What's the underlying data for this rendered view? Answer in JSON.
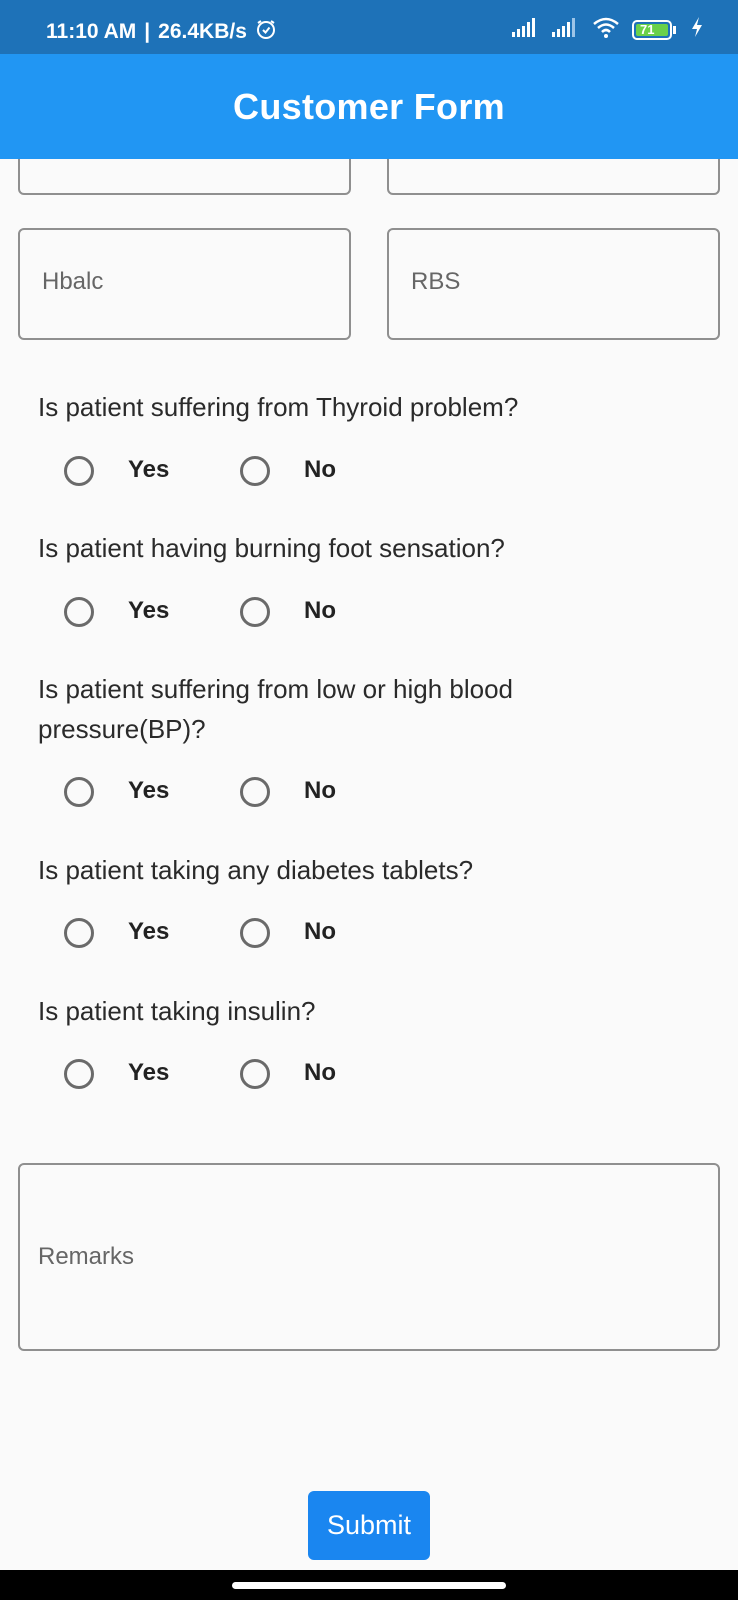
{
  "status_bar": {
    "time": "11:10 AM",
    "speed": "26.4KB/s",
    "battery": "71",
    "icons": [
      "alarm-icon",
      "signal-icon",
      "signal-icon",
      "wifi-icon",
      "battery-icon",
      "charging-icon"
    ]
  },
  "app_bar": {
    "title": "Customer Form"
  },
  "fields": {
    "hba1c_placeholder": "Hbalc",
    "rbs_placeholder": "RBS",
    "remarks_placeholder": "Remarks"
  },
  "questions": [
    {
      "text": "Is patient suffering from Thyroid problem?",
      "yes": "Yes",
      "no": "No"
    },
    {
      "text": "Is patient having burning foot sensation?",
      "yes": "Yes",
      "no": "No"
    },
    {
      "text": "Is patient suffering from low or high blood pressure(BP)?",
      "yes": "Yes",
      "no": "No"
    },
    {
      "text": "Is patient taking any diabetes tablets?",
      "yes": "Yes",
      "no": "No"
    },
    {
      "text": "Is patient taking insulin?",
      "yes": "Yes",
      "no": "No"
    }
  ],
  "submit_label": "Submit",
  "colors": {
    "status_bar": "#1e72b8",
    "app_bar": "#2196f3",
    "submit": "#1a86f0",
    "radio_border": "#6a6a6a"
  }
}
